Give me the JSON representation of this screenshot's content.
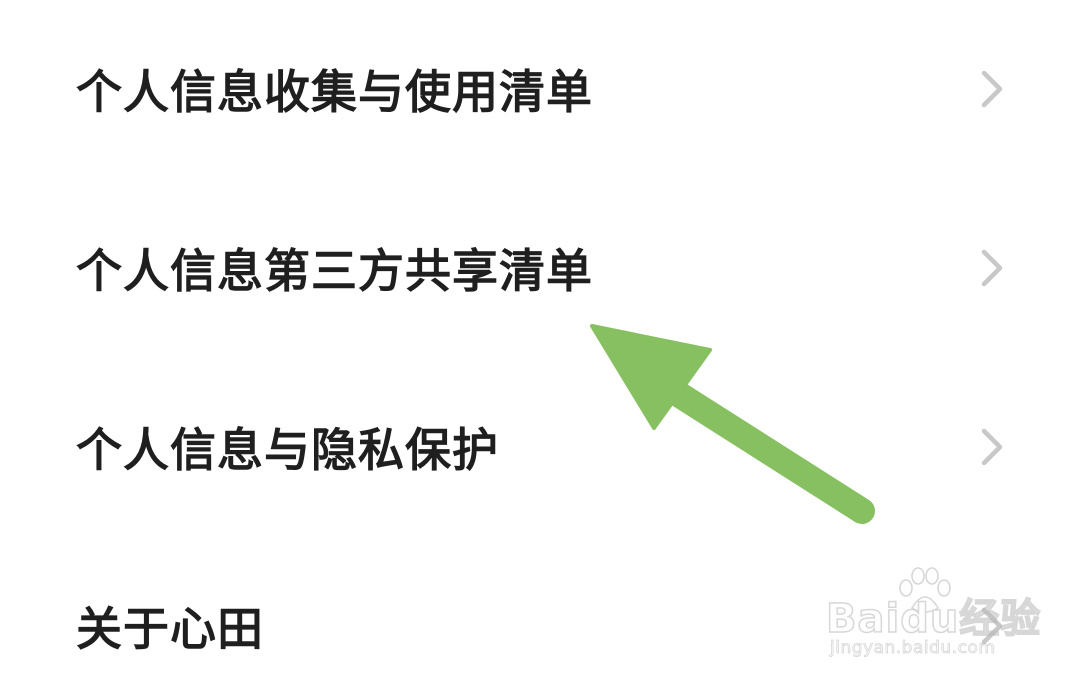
{
  "menu": {
    "items": [
      {
        "label": "个人信息收集与使用清单",
        "icon": "chevron-right-icon"
      },
      {
        "label": "个人信息第三方共享清单",
        "icon": "chevron-right-icon"
      },
      {
        "label": "个人信息与隐私保护",
        "icon": "chevron-right-icon"
      },
      {
        "label": "关于心田",
        "icon": "chevron-right-icon"
      }
    ]
  },
  "annotation": {
    "arrow_color": "#86c060",
    "points_to": "个人信息第三方共享清单"
  },
  "watermark": {
    "logo_text": "Baidu经验",
    "url": "jingyan.baidu.com"
  },
  "colors": {
    "text": "#1f1f1f",
    "chevron": "#c8c8c8",
    "background": "#ffffff"
  }
}
